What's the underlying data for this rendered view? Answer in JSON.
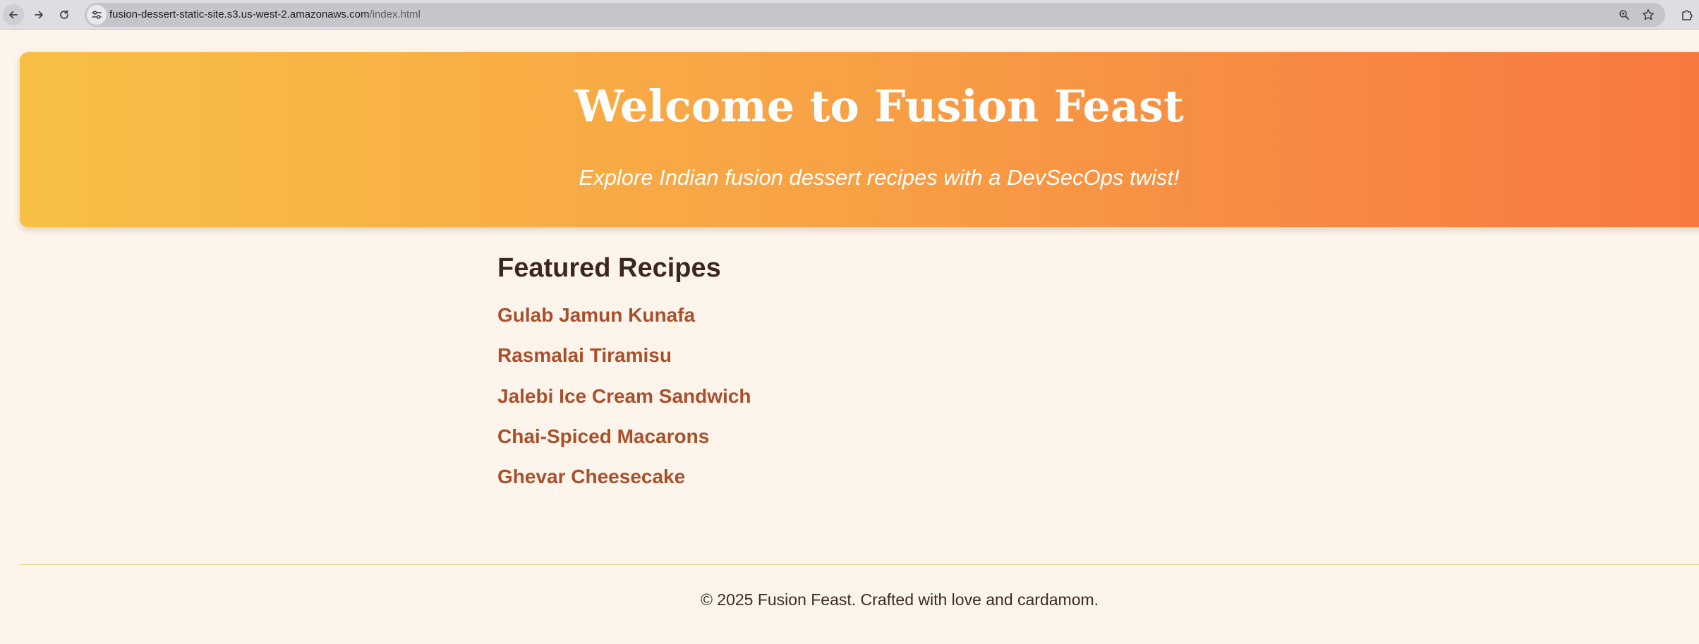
{
  "browser": {
    "url_host": "fusion-dessert-static-site.s3.us-west-2.amazonaws.com",
    "url_path": "/index.html",
    "icons": [
      "back-arrow-icon",
      "forward-arrow-icon",
      "reload-icon",
      "site-settings-icon",
      "zoom-icon",
      "star-icon",
      "extensions-icon"
    ]
  },
  "hero": {
    "title": "Welcome to Fusion Feast",
    "subtitle": "Explore Indian fusion dessert recipes with a DevSecOps twist!",
    "gradient_start": "#f8bf45",
    "gradient_end": "#f7783f"
  },
  "recipes": {
    "heading": "Featured Recipes",
    "items": [
      "Gulab Jamun Kunafa",
      "Rasmalai Tiramisu",
      "Jalebi Ice Cream Sandwich",
      "Chai-Spiced Macarons",
      "Ghevar Cheesecake"
    ],
    "link_color": "#a8502c"
  },
  "footer": {
    "text": "© 2025 Fusion Feast. Crafted with love and cardamom."
  },
  "colors": {
    "page_background": "#fdf5ec",
    "heading_text": "#3c2623"
  }
}
